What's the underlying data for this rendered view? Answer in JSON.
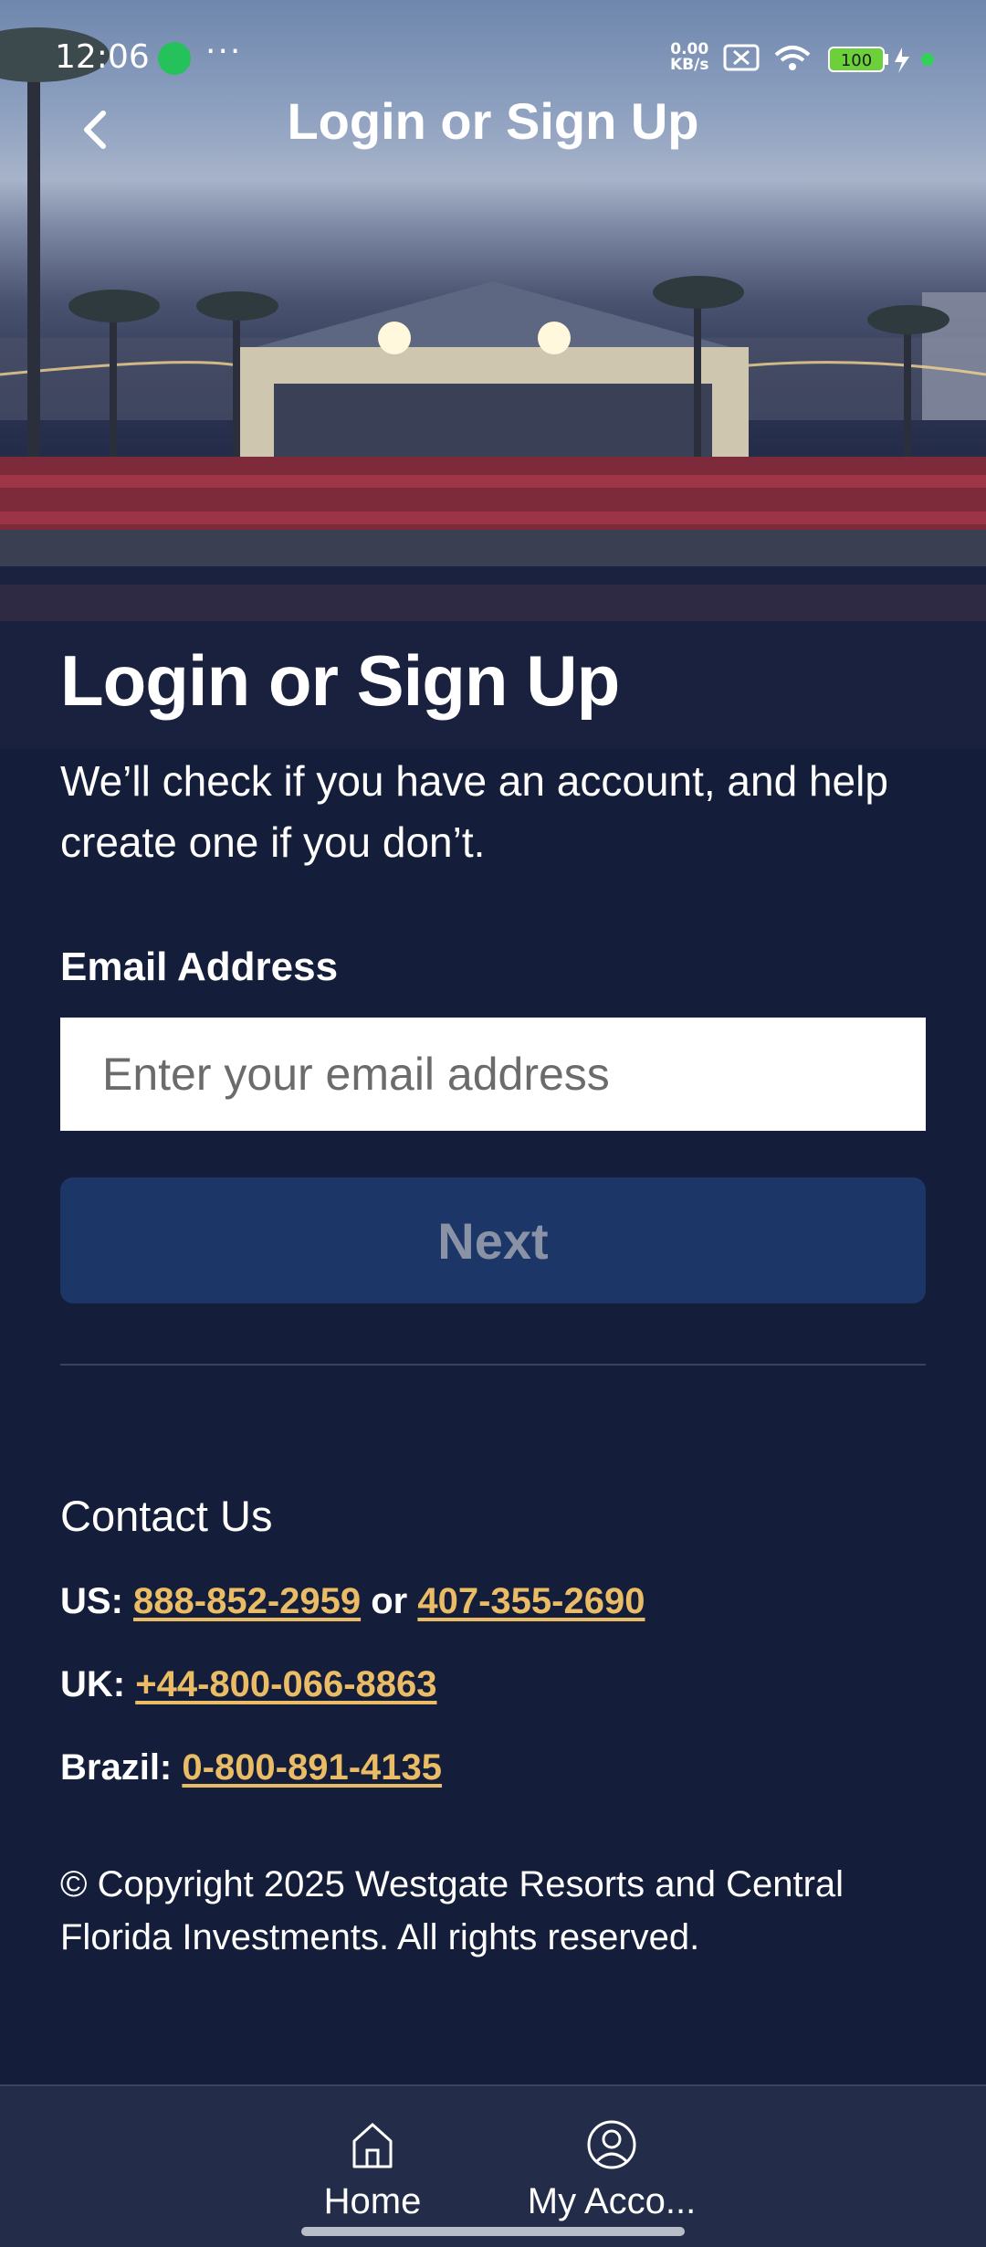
{
  "status_bar": {
    "time": "12:06",
    "more": "···",
    "net_speed_value": "0.00",
    "net_speed_unit": "KB/s",
    "battery": "100"
  },
  "header": {
    "title": "Login or Sign Up"
  },
  "main": {
    "heading": "Login or Sign Up",
    "subtext": "We’ll check if you have an account, and help create one if you don’t.",
    "email_label": "Email Address",
    "email_placeholder": "Enter your email address",
    "email_value": "",
    "next_label": "Next"
  },
  "contact": {
    "title": "Contact Us",
    "us_label": "US:",
    "us_phone_1": "888-852-2959",
    "or": "or",
    "us_phone_2": "407-355-2690",
    "uk_label": "UK:",
    "uk_phone": "+44-800-066-8863",
    "brazil_label": "Brazil:",
    "brazil_phone": "0-800-891-4135"
  },
  "copyright": "© Copyright 2025 Westgate Resorts and Central Florida Investments. All rights reserved.",
  "bottom_nav": {
    "items": [
      {
        "label": "Home",
        "icon": "home-icon"
      },
      {
        "label": "My Acco...",
        "icon": "account-icon"
      }
    ]
  },
  "colors": {
    "background": "#141d3a",
    "button": "#1d3668",
    "link": "#e9bc65",
    "nav": "#232d49"
  }
}
